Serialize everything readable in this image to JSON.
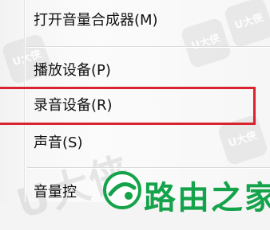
{
  "menu": {
    "items": [
      {
        "label": "打开音量合成器(M)"
      },
      {
        "label": "播放设备(P)"
      },
      {
        "label": "录音设备(R)"
      },
      {
        "label": "声音(S)"
      },
      {
        "label": "音量控"
      }
    ]
  },
  "watermark": {
    "stamp_text": "U大侠",
    "big_text": "U大侠"
  },
  "logo": {
    "text": "路由之家"
  },
  "colors": {
    "highlight": "#d9232e",
    "logo_green": "#14a34a"
  }
}
